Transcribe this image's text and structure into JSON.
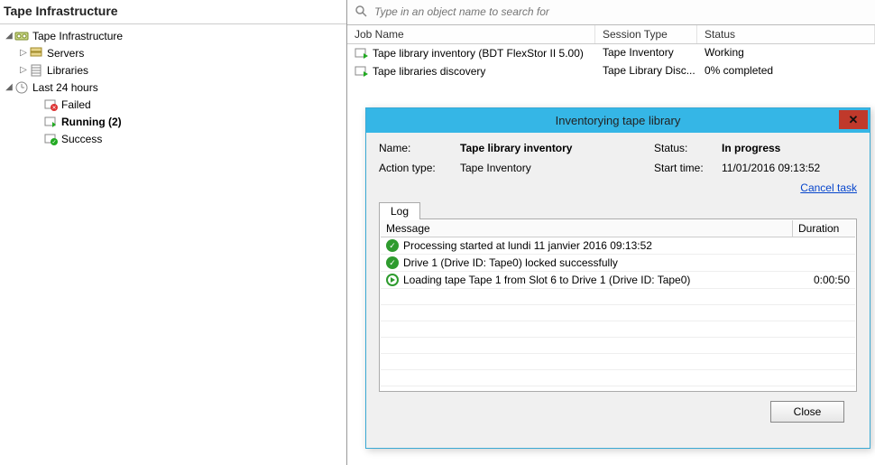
{
  "left_panel": {
    "title": "Tape Infrastructure",
    "tree": [
      {
        "label": "Tape Infrastructure"
      },
      {
        "label": "Servers"
      },
      {
        "label": "Libraries"
      },
      {
        "label": "Last 24 hours"
      },
      {
        "label": "Failed"
      },
      {
        "label": "Running (2)"
      },
      {
        "label": "Success"
      }
    ]
  },
  "search": {
    "placeholder": "Type in an object name to search for"
  },
  "grid": {
    "headers": {
      "job": "Job Name",
      "type": "Session Type",
      "status": "Status"
    },
    "rows": [
      {
        "job": "Tape library inventory (BDT FlexStor II 5.00)",
        "type": "Tape Inventory",
        "status": "Working"
      },
      {
        "job": "Tape libraries discovery",
        "type": "Tape Library Disc...",
        "status": "0% completed"
      }
    ]
  },
  "dialog": {
    "title": "Inventorying tape library",
    "summary": {
      "name_label": "Name:",
      "name_value": "Tape library inventory",
      "action_label": "Action type:",
      "action_value": "Tape Inventory",
      "status_label": "Status:",
      "status_value": "In progress",
      "start_label": "Start time:",
      "start_value": "11/01/2016 09:13:52"
    },
    "cancel_link": "Cancel task",
    "tab_label": "Log",
    "log": {
      "headers": {
        "msg": "Message",
        "dur": "Duration"
      },
      "entries": [
        {
          "status": "ok",
          "msg": "Processing started at lundi 11 janvier 2016 09:13:52",
          "dur": ""
        },
        {
          "status": "ok",
          "msg": "Drive 1 (Drive ID: Tape0) locked successfully",
          "dur": ""
        },
        {
          "status": "progress",
          "msg": "Loading tape Tape 1 from Slot 6 to Drive 1 (Drive ID: Tape0)",
          "dur": "0:00:50"
        }
      ]
    },
    "close_button": "Close"
  }
}
